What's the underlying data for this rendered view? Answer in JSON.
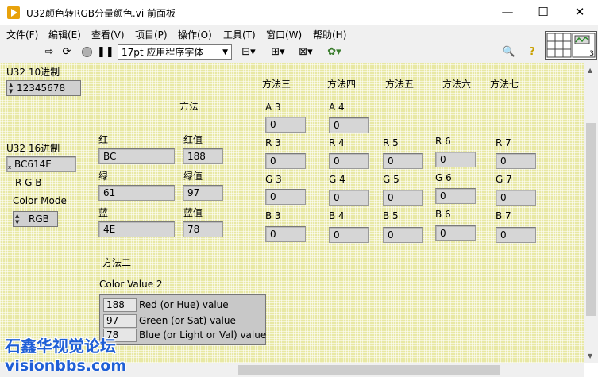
{
  "window": {
    "title": "U32颜色转RGB分量颜色.vi 前面板",
    "minimize": "—",
    "maximize": "☐",
    "close": "✕"
  },
  "menu": [
    "文件(F)",
    "编辑(E)",
    "查看(V)",
    "项目(P)",
    "操作(O)",
    "工具(T)",
    "窗口(W)",
    "帮助(H)"
  ],
  "toolbar": {
    "font": "17pt 应用程序字体",
    "conn_number": "3"
  },
  "panel": {
    "u32_dec": {
      "label": "U32 10进制",
      "value": "12345678"
    },
    "u32_hex": {
      "label": "U32 16进制",
      "value": "BC614E"
    },
    "rgb_letters": "R  G  B",
    "color_mode": {
      "label": "Color Mode",
      "value": "RGB"
    },
    "method1": {
      "title": "方法一",
      "red_label": "红",
      "red_hex": "BC",
      "green_label": "绿",
      "green_hex": "61",
      "blue_label": "蓝",
      "blue_hex": "4E",
      "red_val_label": "红值",
      "red_val": "188",
      "green_val_label": "绿值",
      "green_val": "97",
      "blue_val_label": "蓝值",
      "blue_val": "78"
    },
    "method2": {
      "title": "方法二",
      "cluster_label": "Color Value 2",
      "rows": [
        {
          "value": "188",
          "label": "Red (or Hue) value"
        },
        {
          "value": "97",
          "label": "Green (or Sat) value"
        },
        {
          "value": "78",
          "label": "Blue (or Light or Val) value"
        }
      ]
    },
    "method3": {
      "title": "方法三",
      "a": "A 3",
      "a_val": "0",
      "r": "R 3",
      "r_val": "0",
      "g": "G 3",
      "g_val": "0",
      "b": "B 3",
      "b_val": "0"
    },
    "method4": {
      "title": "方法四",
      "a": "A 4",
      "a_val": "0",
      "r": "R 4",
      "r_val": "0",
      "g": "G 4",
      "g_val": "0",
      "b": "B 4",
      "b_val": "0"
    },
    "method5": {
      "title": "方法五",
      "r": "R 5",
      "r_val": "0",
      "g": "G 5",
      "g_val": "0",
      "b": "B 5",
      "b_val": "0"
    },
    "method6": {
      "title": "方法六",
      "r": "R 6",
      "r_val": "0",
      "g": "G 6",
      "g_val": "0",
      "b": "B 6",
      "b_val": "0"
    },
    "method7": {
      "title": "方法七",
      "r": "R 7",
      "r_val": "0",
      "g": "G 7",
      "g_val": "0",
      "b": "B 7",
      "b_val": "0"
    }
  },
  "watermark": {
    "line1": "石鑫华视觉论坛",
    "line2": "visionbbs.com"
  }
}
